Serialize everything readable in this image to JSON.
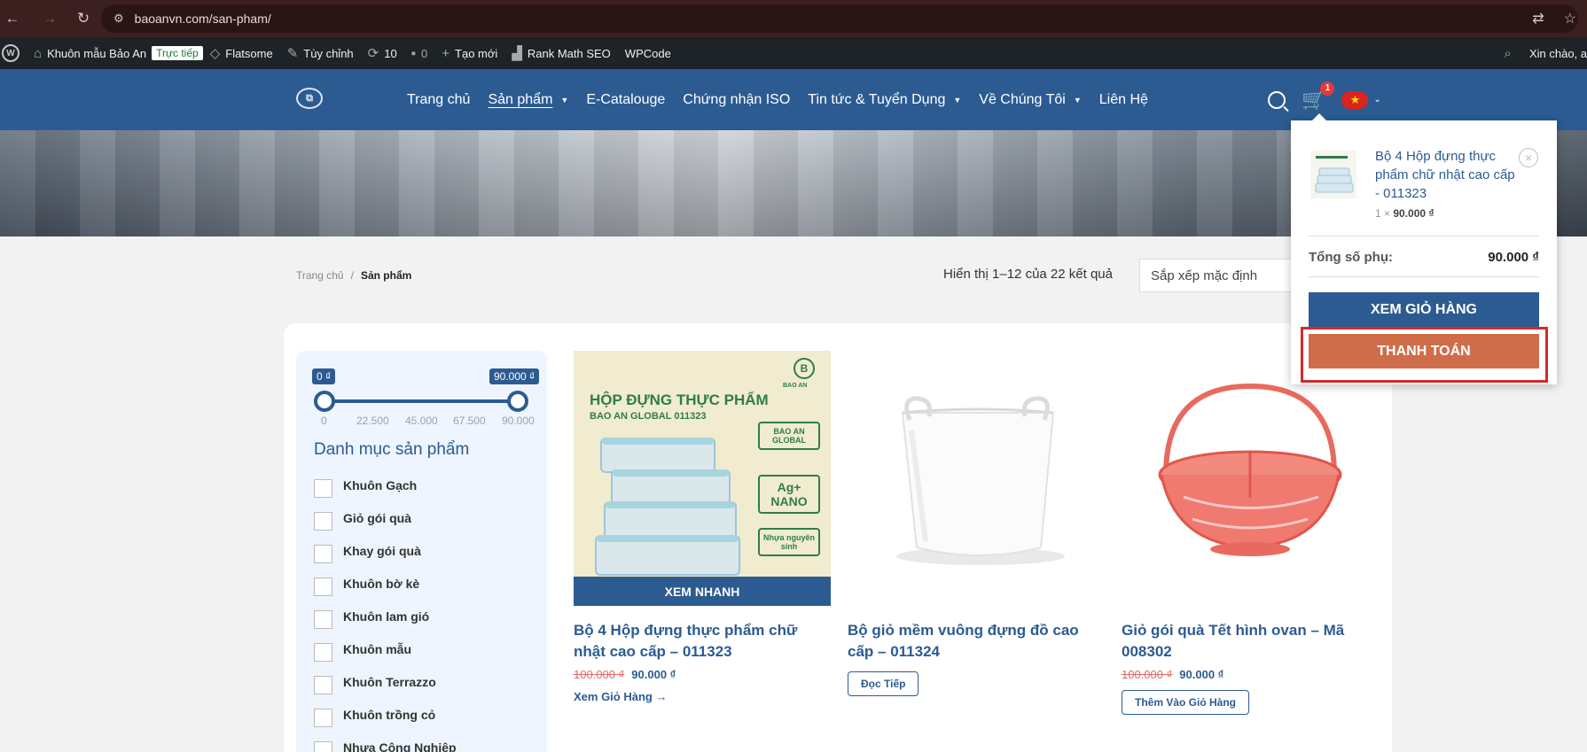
{
  "browser": {
    "url": "baoanvn.com/san-pham/"
  },
  "adminbar": {
    "site_name": "Khuôn mẫu Bảo An",
    "live_label": "Trực tiếp",
    "theme": "Flatsome",
    "customize": "Tùy chỉnh",
    "updates_count": "10",
    "comments_count": "0",
    "new_label": "Tạo mới",
    "seo": "Rank Math SEO",
    "wpcode": "WPCode",
    "greeting": "Xin chào, a"
  },
  "nav": {
    "items": [
      {
        "label": "Trang chủ",
        "has_caret": false,
        "active": false
      },
      {
        "label": "Sản phẩm",
        "has_caret": true,
        "active": true
      },
      {
        "label": "E-Catalouge",
        "has_caret": false,
        "active": false
      },
      {
        "label": "Chứng nhận ISO",
        "has_caret": false,
        "active": false
      },
      {
        "label": "Tin tức & Tuyển Dụng",
        "has_caret": true,
        "active": false
      },
      {
        "label": "Về Chúng Tôi",
        "has_caret": true,
        "active": false
      },
      {
        "label": "Liên Hệ",
        "has_caret": false,
        "active": false
      }
    ],
    "cart_count": "1"
  },
  "breadcrumb": {
    "home": "Trang chủ",
    "separator": "/",
    "current": "Sản phẩm"
  },
  "results": {
    "count_text": "Hiển thị 1–12 của 22 kết quả",
    "sort_value": "Sắp xếp mặc định"
  },
  "filter": {
    "price_min": "0 ₫",
    "price_max": "90.000 ₫",
    "ticks": [
      "0",
      "22.500",
      "45.000",
      "67.500",
      "90.000"
    ],
    "category_title": "Danh mục sản phẩm",
    "categories": [
      "Khuôn Gạch",
      "Giỏ gói quà",
      "Khay gói quà",
      "Khuôn bờ kè",
      "Khuôn lam gió",
      "Khuôn mẫu",
      "Khuôn Terrazzo",
      "Khuôn trồng cỏ",
      "Nhựa Công Nghiệp"
    ]
  },
  "products": [
    {
      "title": "Bộ 4 Hộp đựng thực phẩm chữ nhật cao cấp – 011323",
      "old_price": "100.000 ₫",
      "price": "90.000 ₫",
      "action": "Xem Giỏ Hàng →",
      "quick_view": "XEM NHANH",
      "image_heading": "HỘP ĐỰNG THỰC PHẨM",
      "image_sub": "BAO AN GLOBAL 011323",
      "image_brand": "BAO AN",
      "image_features": [
        "BAO AN GLOBAL",
        "Ag+ NANO",
        "Nhựa nguyên sinh"
      ]
    },
    {
      "title": "Bộ giỏ mềm vuông đựng đồ cao cấp – 011324",
      "old_price": "",
      "price": "",
      "action": "Đọc Tiếp"
    },
    {
      "title": "Giỏ gói quà Tết hình ovan – Mã 008302",
      "old_price": "100.000 ₫",
      "price": "90.000 ₫",
      "action": "Thêm Vào Giỏ Hàng"
    }
  ],
  "mini_cart": {
    "item_name": "Bộ 4 Hộp đựng thực phẩm chữ nhật cao cấp - 011323",
    "qty": "1 ×",
    "item_price": "90.000 ₫",
    "subtotal_label": "Tổng số phụ:",
    "subtotal_value": "90.000 ₫",
    "view_cart": "XEM GIỎ HÀNG",
    "checkout": "THANH TOÁN"
  },
  "colors": {
    "brand": "#2c5b92",
    "checkout": "#cf6d4b",
    "highlight": "#d42a2a"
  }
}
